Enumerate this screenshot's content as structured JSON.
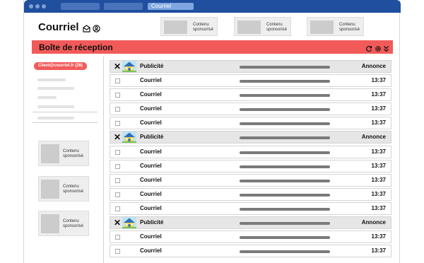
{
  "window": {
    "active_tab": "Courriel"
  },
  "header": {
    "logo": "Courriel"
  },
  "sponsored_top": [
    {
      "label": "Contenu sponsorisé"
    },
    {
      "label": "Contenu sponsorisé"
    },
    {
      "label": "Contenu sponsorisé"
    }
  ],
  "banner": {
    "title": "Boîte de réception"
  },
  "sidebar": {
    "account": "Client@courriel.fr",
    "count": "(28)",
    "sponsored": [
      {
        "label": "Contenu sponsorisé"
      },
      {
        "label": "Contenu sponsorisé"
      },
      {
        "label": "Contenu sponsorisé"
      }
    ]
  },
  "messages": [
    {
      "type": "ad",
      "sender": "Publicité",
      "time": "Annonce"
    },
    {
      "type": "mail",
      "sender": "Courriel",
      "time": "13:37"
    },
    {
      "type": "mail",
      "sender": "Courriel",
      "time": "13:37"
    },
    {
      "type": "mail",
      "sender": "Courriel",
      "time": "13:37"
    },
    {
      "type": "mail",
      "sender": "Courriel",
      "time": "13:37"
    },
    {
      "type": "ad",
      "sender": "Publicité",
      "time": "Annonce"
    },
    {
      "type": "mail",
      "sender": "Courriel",
      "time": "13:37"
    },
    {
      "type": "mail",
      "sender": "Courriel",
      "time": "13:37"
    },
    {
      "type": "mail",
      "sender": "Courriel",
      "time": "13:37"
    },
    {
      "type": "mail",
      "sender": "Courriel",
      "time": "13:37"
    },
    {
      "type": "mail",
      "sender": "Courriel",
      "time": "13:37"
    },
    {
      "type": "ad",
      "sender": "Publicité",
      "time": "Annonce"
    },
    {
      "type": "mail",
      "sender": "Courriel",
      "time": "13:37"
    },
    {
      "type": "mail",
      "sender": "Courriel",
      "time": "13:37"
    }
  ],
  "colors": {
    "titlebar": "#1f4f9e",
    "accent": "#f25a5a"
  },
  "icons": {
    "header": [
      "mail-icon",
      "user-icon"
    ],
    "banner": [
      "refresh-icon",
      "settings-icon",
      "collapse-icon"
    ],
    "ad_row": [
      "close-icon",
      "house-ad-icon"
    ]
  }
}
